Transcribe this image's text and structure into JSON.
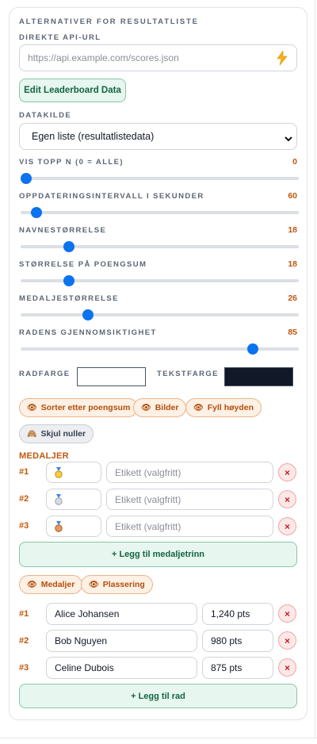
{
  "panel": {
    "title": "ALTERNATIVER FOR RESULTATLISTE",
    "api": {
      "label": "DIREKTE API-URL",
      "placeholder": "https://api.example.com/scores.json",
      "icon": "lightning-icon"
    },
    "edit_button": "Edit Leaderboard Data",
    "datasource": {
      "label": "DATAKILDE",
      "selected": "Egen liste (resultatlistedata)"
    },
    "sliders": [
      {
        "label": "VIS TOPP N (0 = ALLE)",
        "value": "0",
        "fraction": 0.0
      },
      {
        "label": "OPPDATERINGSINTERVALL I SEKUNDER",
        "value": "60",
        "fraction": 0.04
      },
      {
        "label": "NAVNESTØRRELSE",
        "value": "18",
        "fraction": 0.16
      },
      {
        "label": "STØRRELSE PÅ POENGSUM",
        "value": "18",
        "fraction": 0.16
      },
      {
        "label": "MEDALJESTØRRELSE",
        "value": "26",
        "fraction": 0.23
      },
      {
        "label": "RADENS GJENNOMSIKTIGHET",
        "value": "85",
        "fraction": 0.85
      }
    ],
    "colors": {
      "row_label": "RADFARGE",
      "row_color": "#ffffff",
      "text_label": "TEKSTFARGE",
      "text_color": "#111827"
    },
    "toggles": [
      {
        "label": "Sorter etter poengsum",
        "icon": "eye-icon",
        "state": "on"
      },
      {
        "label": "Bilder",
        "icon": "eye-icon",
        "state": "on"
      },
      {
        "label": "Fyll høyden",
        "icon": "eye-icon",
        "state": "on"
      },
      {
        "label": "Skjul nuller",
        "icon": "eye-off-icon",
        "state": "off"
      }
    ],
    "medals": {
      "title": "MEDALJER",
      "rows": [
        {
          "rank": "#1",
          "medal": "gold",
          "label_placeholder": "Etikett (valgfritt)"
        },
        {
          "rank": "#2",
          "medal": "silver",
          "label_placeholder": "Etikett (valgfritt)"
        },
        {
          "rank": "#3",
          "medal": "bronze",
          "label_placeholder": "Etikett (valgfritt)"
        }
      ],
      "add_button": "+ Legg til medaljetrinn"
    },
    "columns": [
      {
        "label": "Medaljer",
        "icon": "eye-icon"
      },
      {
        "label": "Plassering",
        "icon": "eye-icon"
      }
    ],
    "entries": [
      {
        "rank": "#1",
        "name": "Alice Johansen",
        "score": "1,240 pts"
      },
      {
        "rank": "#2",
        "name": "Bob Nguyen",
        "score": "980 pts"
      },
      {
        "rank": "#3",
        "name": "Celine Dubois",
        "score": "875 pts"
      }
    ],
    "add_row_button": "+ Legg til rad",
    "delete_symbol": "×"
  },
  "accent": "#c2570c",
  "slider_color": "#0b72f0"
}
